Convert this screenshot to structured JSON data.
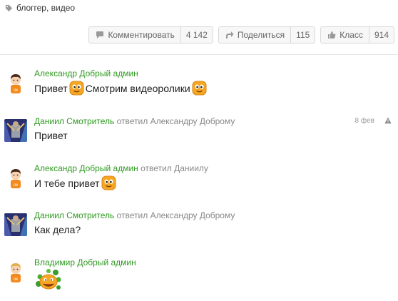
{
  "tags": {
    "text": "блоггер, видео",
    "icon": "tag-icon"
  },
  "actions": [
    {
      "label": "Комментировать",
      "count": "4 142",
      "icon": "comment-icon"
    },
    {
      "label": "Поделиться",
      "count": "115",
      "icon": "share-icon"
    },
    {
      "label": "Класс",
      "count": "914",
      "icon": "like-icon"
    }
  ],
  "comments": [
    {
      "author": "Александр Добрый админ",
      "reply_prefix": "",
      "reply_to": "",
      "text_parts": [
        "Привет",
        "Смотрим видеоролики"
      ],
      "date": ""
    },
    {
      "author": "Даниил Смотритель",
      "reply_prefix": "ответил",
      "reply_to": "Александру Доброму",
      "text_parts": [
        "Привет"
      ],
      "date": "8 фев"
    },
    {
      "author": "Александр Добрый админ",
      "reply_prefix": "ответил",
      "reply_to": "Даниилу",
      "text_parts": [
        "И тебе привет"
      ],
      "date": ""
    },
    {
      "author": "Даниил Смотритель",
      "reply_prefix": "ответил",
      "reply_to": "Александру Доброму",
      "text_parts": [
        "Как дела?"
      ],
      "date": ""
    },
    {
      "author": "Владимир Добрый админ",
      "reply_prefix": "",
      "reply_to": "",
      "text_parts": [],
      "date": ""
    }
  ],
  "colors": {
    "author": "#2e9a1f",
    "muted": "#888888",
    "smiley": "#f5a623"
  }
}
